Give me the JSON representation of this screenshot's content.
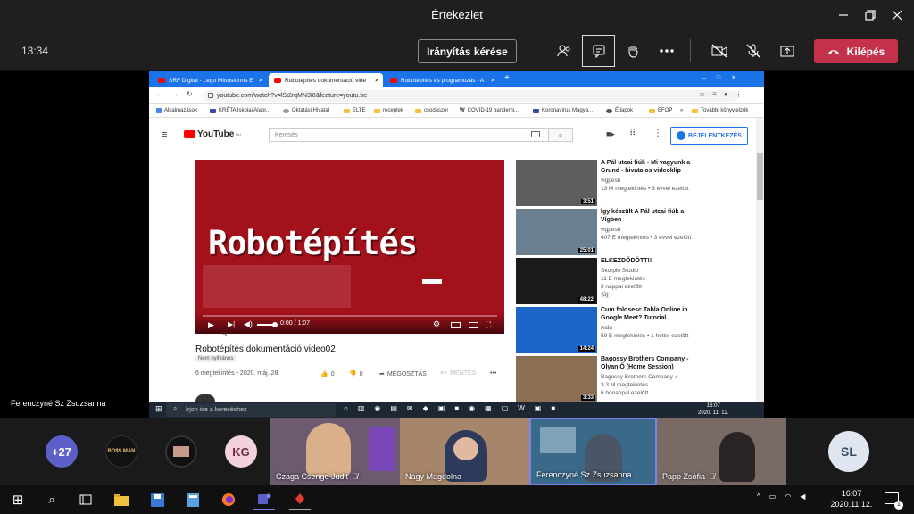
{
  "window": {
    "title": "Értekezlet"
  },
  "toolbar": {
    "timer": "13:34",
    "control_request": "Irányítás kérése",
    "leave": "Kilépés"
  },
  "browser": {
    "tabs": [
      {
        "label": "SRF Digital - Lego Mindstorms E"
      },
      {
        "label": "Robotépítés dokumentáció vide"
      },
      {
        "label": "Robotépítés és programozás - A"
      }
    ],
    "url": "youtube.com/watch?v=lSt2rqMN3I8&feature=youtu.be",
    "bookmarks": [
      "Alkalmazások",
      "KRÉTA Iskolai Alapr...",
      "Oktatási Hivatal",
      "ELTE",
      "receptek",
      "csodaszer",
      "COVID-19 pandemi...",
      "Koronavírus Magya...",
      "Étlapok",
      "EFOP",
      "»",
      "További könyvjelzők"
    ]
  },
  "youtube": {
    "logo": "YouTube",
    "logo_sup": "HU",
    "search_placeholder": "Keresés",
    "signin": "BEJELENTKEZÉS",
    "video_overlay_text": "Robotépítés",
    "video_time": "0:00 / 1:07",
    "video_title": "Robotépítés dokumentáció video02",
    "unlisted": "Nem nyilvános",
    "meta": "6 megtekintés • 2020. máj. 28.",
    "likes": "0",
    "dislikes": "0",
    "share": "MEGOSZTÁS",
    "save": "MENTÉS",
    "recommendations": [
      {
        "title": "A Pál utcai fiúk - Mi vagyunk a Grund - hivatalos videoklip",
        "channel": "vigpesti",
        "stats": "13 M megtekintés • 3 évvel ezelőtt",
        "extra": "",
        "duration": "3:51",
        "color": "#5e5e5e"
      },
      {
        "title": "Így készült A Pál utcai fiúk a Vígben",
        "channel": "vigpesti",
        "stats": "607 E megtekintés • 3 évvel ezelőtt",
        "extra": "",
        "duration": "25:01",
        "color": "#6a7f90"
      },
      {
        "title": "ELKEZDŐDÖTT!!",
        "channel": "Skorpio Studio",
        "stats": "11 E megtekintés",
        "extra": "3 nappal ezelőtt",
        "extra2": "Új",
        "duration": "48:22",
        "color": "#1b1b1b"
      },
      {
        "title": "Cum folosesc Tabla Online in Google Meet? Tutorial...",
        "channel": "Aidu",
        "stats": "59 E megtekintés • 1 héttel ezelőtt",
        "extra": "",
        "duration": "14:24",
        "color": "#1d64c8"
      },
      {
        "title": "Bagossy Brothers Company - Olyan Ő (Home Session)",
        "channel": "Bagossy Brothers Company ♪",
        "stats": "3,3 M megtekintés",
        "extra": "6 hónappal ezelőtt",
        "duration": "3:33",
        "color": "#8a6f55"
      }
    ]
  },
  "inner_taskbar": {
    "search_placeholder": "Írjon ide a kereséshez",
    "time": "16:07",
    "date": "2020. 11. 12."
  },
  "presenter": "Ferenczyné Sz Zsuzsanna",
  "participants": {
    "overflow": "+27",
    "initials_1": "KG",
    "initials_2": "SL",
    "bossman": "BO$$ MAN",
    "tiles": [
      {
        "name": "Czaga Csenge Judit",
        "color": "#6b5a70"
      },
      {
        "name": "Nagy Magdolna",
        "color": "#a5866a"
      },
      {
        "name": "Ferenczyné Sz Zsuzsanna",
        "color": "#3a6a8a"
      },
      {
        "name": "Papp Zsófia",
        "color": "#7a6a66"
      }
    ]
  },
  "taskbar": {
    "time": "16:07",
    "date": "2020.11.12.",
    "notifications": "1"
  }
}
